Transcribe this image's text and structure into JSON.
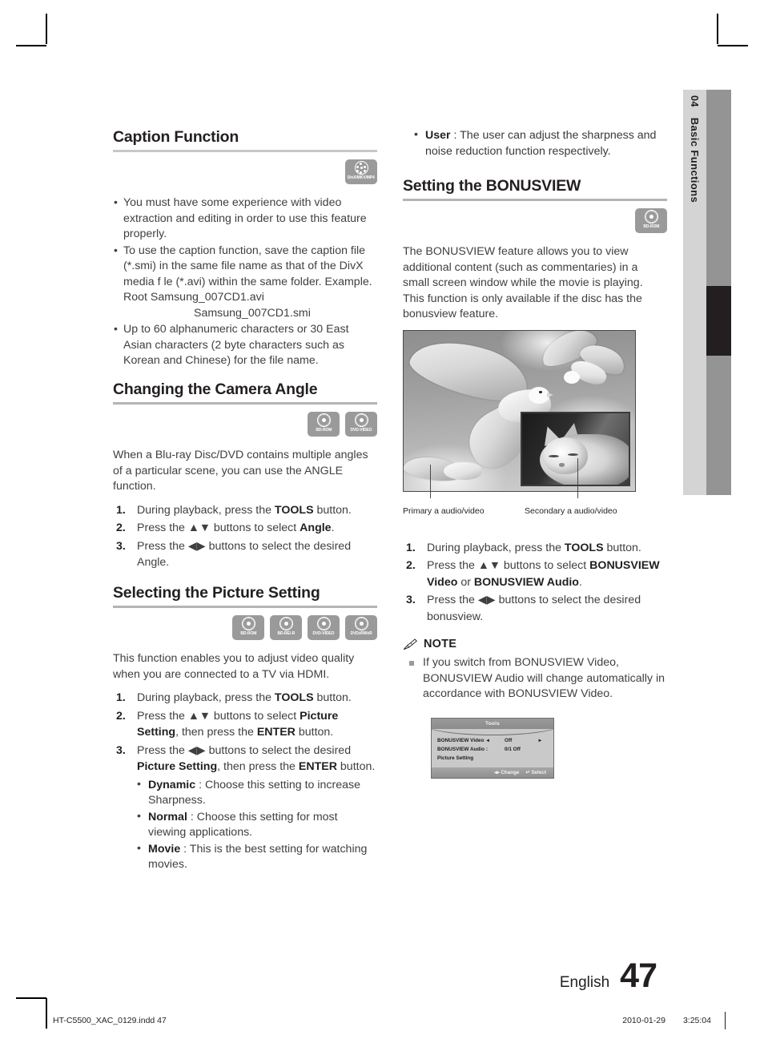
{
  "side_tab": {
    "chapter_number": "04",
    "chapter_title": "Basic Functions"
  },
  "left_column": {
    "caption_section": {
      "heading": "Caption Function",
      "icons": [
        {
          "name": "divx-mkv-mp4-icon",
          "label": "DivX/MKV/MP4"
        }
      ],
      "bullets": [
        "You must have some experience with video extraction and editing in order to use this feature properly.",
        "To use the caption function, save the caption file (*.smi) in the same file name as that of the DivX media f le (*.avi) within the same folder. Example. Root Samsung_007CD1.avi",
        "Up to 60 alphanumeric characters or 30 East Asian characters (2 byte characters such as Korean and Chinese) for the file name."
      ],
      "bullet2_indent_line": "Samsung_007CD1.smi"
    },
    "camera_angle_section": {
      "heading": "Changing the Camera Angle",
      "icons": [
        {
          "name": "bd-rom-icon",
          "label": "BD-ROM"
        },
        {
          "name": "dvd-video-icon",
          "label": "DVD-VIDEO"
        }
      ],
      "intro": "When a Blu-ray Disc/DVD contains multiple angles of a particular scene, you can use the ANGLE function.",
      "steps": [
        {
          "pre": "During playback, press the ",
          "bold": "TOOLS",
          "post": " button."
        },
        {
          "pre": "Press the ▲▼ buttons to select ",
          "bold": "Angle",
          "post": "."
        },
        {
          "pre": "Press the ◀▶ buttons to select the desired Angle.",
          "bold": "",
          "post": ""
        }
      ]
    },
    "picture_setting_section": {
      "heading": "Selecting the Picture Setting",
      "icons": [
        {
          "name": "bd-rom-icon",
          "label": "BD-ROM"
        },
        {
          "name": "bd-re-r-icon",
          "label": "BD-RE/-R"
        },
        {
          "name": "dvd-video-icon",
          "label": "DVD-VIDEO"
        },
        {
          "name": "dvd-rw-r-icon",
          "label": "DVD±RW±R"
        }
      ],
      "intro": "This function enables you to adjust video quality when you are connected to a TV via HDMI.",
      "step1_pre": "During playback, press the ",
      "step1_bold": "TOOLS",
      "step1_post": " button.",
      "step2_pre": "Press the ▲▼ buttons to select ",
      "step2_bold": "Picture Setting",
      "step2_mid": ", then press the ",
      "step2_bold2": "ENTER",
      "step2_post": " button.",
      "step3_pre": "Press the ◀▶ buttons to select the desired ",
      "step3_bold": "Picture Setting",
      "step3_mid": ", then press the ",
      "step3_bold2": "ENTER",
      "step3_post": " button.",
      "options": [
        {
          "term": "Dynamic",
          "desc": " : Choose this setting to increase Sharpness."
        },
        {
          "term": "Normal",
          "desc": " : Choose this setting for most viewing applications."
        },
        {
          "term": "Movie",
          "desc": " : This is the best setting for watching movies."
        }
      ]
    }
  },
  "right_column": {
    "user_option": {
      "term": "User",
      "desc": " : The user can adjust the sharpness and noise reduction function respectively."
    },
    "bonusview_section": {
      "heading": "Setting the BONUSVIEW",
      "icons": [
        {
          "name": "bd-rom-icon",
          "label": "BD-ROM"
        }
      ],
      "intro": "The BONUSVIEW feature allows you to view additional content (such as commentaries) in a small screen window while the movie is playing. This function is only available if the disc has the bonusview feature.",
      "figure_captions": {
        "primary": "Primary a audio/video",
        "secondary": "Secondary a audio/video"
      },
      "step1_pre": "During playback, press the ",
      "step1_bold": "TOOLS",
      "step1_post": " button.",
      "step2_pre": "Press the ▲▼ buttons to select ",
      "step2_bold": "BONUSVIEW Video",
      "step2_mid": " or ",
      "step2_bold2": "BONUSVIEW Audio",
      "step2_post": ".",
      "step3_text": "Press the ◀▶ buttons to select the desired bonusview."
    },
    "note": {
      "title": "NOTE",
      "items": [
        "If you switch from BONUSVIEW Video, BONUSVIEW Audio will change automatically in accordance with BONUSVIEW Video."
      ]
    },
    "osd_menu": {
      "title": "Tools",
      "rows": [
        {
          "label": "BONUSVIEW Video",
          "arrow_left": "◂",
          "value": "Off",
          "arrow_right": "▸"
        },
        {
          "label": "BONUSVIEW Audio :",
          "arrow_left": "",
          "value": "0/1 Off",
          "arrow_right": ""
        },
        {
          "label": "Picture Setting",
          "arrow_left": "",
          "value": "",
          "arrow_right": ""
        }
      ],
      "footer_change": "◂▸ Change",
      "footer_select": "↵ Select"
    }
  },
  "page_footer": {
    "language": "English",
    "page_number": "47"
  },
  "print_footer": {
    "file_name": "HT-C5500_XAC_0129.indd   47",
    "date": "2010-01-29",
    "time": "3:25:04"
  }
}
